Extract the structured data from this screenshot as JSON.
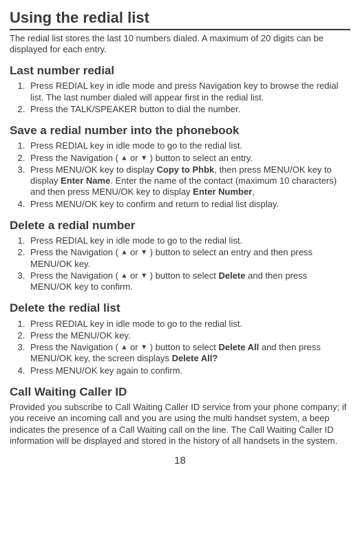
{
  "title": "Using the redial list",
  "intro": "The redial list stores the last 10 numbers dialed. A maximum of 20 digits can be displayed for each entry.",
  "section1": {
    "heading": "Last number redial",
    "items": [
      "Press REDIAL key in idle mode and press Navigation key to browse the redial list. The last number dialed will appear first in the redial list.",
      "Press the TALK/SPEAKER button to dial the number."
    ]
  },
  "section2": {
    "heading": "Save a redial number into the phonebook",
    "items": {
      "i1": "Press REDIAL key in idle mode to go to the redial list.",
      "i2a": "Press the Navigation ( ",
      "or": " or ",
      "i2b": " ) button to select an entry.",
      "i3a": "Press MENU/OK key to display ",
      "copy": "Copy to Phbk",
      "i3b": ", then press MENU/OK key to display ",
      "ename": "Enter Name",
      "i3c": ". Enter the name of the contact (maximum 10 characters) and then press MENU/OK key to display ",
      "enum": "Enter Number",
      "i3d": ",",
      "i4": "Press MENU/OK key to confirm and return to redial list display."
    }
  },
  "section3": {
    "heading": "Delete a redial number",
    "items": {
      "i1": "Press REDIAL key in idle mode to go to the redial list.",
      "i2a": "Press the Navigation ( ",
      "or": " or ",
      "i2b": " ) button to select an entry and then press MENU/OK key.",
      "i3a": "Press the Navigation ( ",
      "i3b": " ) button to select ",
      "delete": "Delete",
      "i3c": " and then press MENU/OK key to confirm."
    }
  },
  "section4": {
    "heading": "Delete the redial list",
    "items": {
      "i1": "Press REDIAL key in idle mode to go to the redial list.",
      "i2": "Press the MENU/OK key.",
      "i3a": "Press the Navigation ( ",
      "or": " or ",
      "i3b": " ) button to select ",
      "delall": "Delete All",
      "i3c": " and then press MENU/OK key, the screen displays ",
      "delallq": "Delete All?",
      "i4": "Press MENU/OK key again to confirm."
    }
  },
  "section5": {
    "heading": "Call Waiting Caller ID",
    "para": "Provided you subscribe to Call Waiting Caller ID service from your phone company; if you receive an incoming call and you are using the multi handset system, a beep indicates the presence of a Call Waiting call on the line. The Call Waiting Caller ID information will be displayed and stored in the history of all handsets in the system."
  },
  "up": "▲",
  "down": "▼",
  "page": "18"
}
